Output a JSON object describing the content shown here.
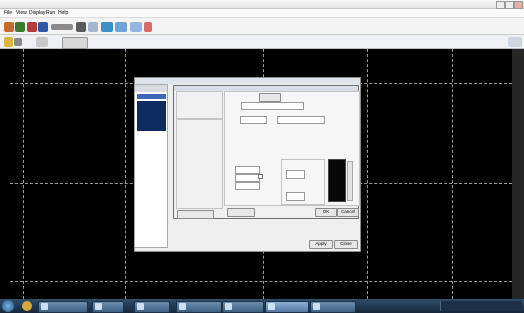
{
  "menu": [
    "File",
    "View",
    "Display",
    "Run",
    "Help"
  ],
  "inner_dialog": {
    "ok_label": "OK",
    "cancel_label": "Cancel"
  },
  "outer_dialog": {
    "apply_label": "Apply",
    "close_label": "Close"
  }
}
